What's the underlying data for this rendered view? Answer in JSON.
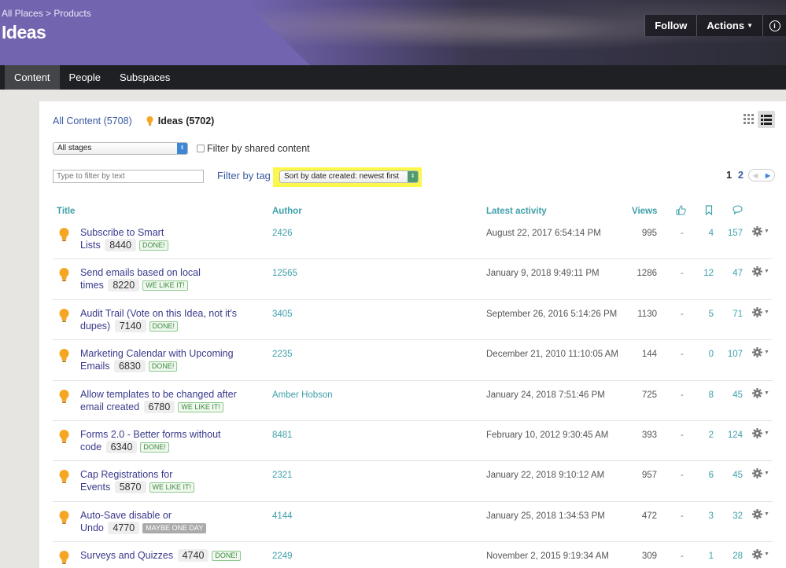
{
  "header": {
    "breadcrumb_root": "All Places",
    "breadcrumb_sep": ">",
    "breadcrumb_current": "Products",
    "title": "Ideas",
    "follow_label": "Follow",
    "actions_label": "Actions",
    "info_label": "i"
  },
  "nav": {
    "tabs": [
      {
        "label": "Content",
        "active": true
      },
      {
        "label": "People",
        "active": false
      },
      {
        "label": "Subspaces",
        "active": false
      }
    ]
  },
  "content": {
    "all_content_label": "All Content (5708)",
    "ideas_label": "Ideas (5702)",
    "stage_select_value": "All stages",
    "shared_filter_label": "Filter by shared content",
    "text_filter_placeholder": "Type to filter by text",
    "tag_filter_label": "Filter by tag",
    "sort_value": "Sort by date created: newest first",
    "pager": {
      "current": "1",
      "next": "2"
    }
  },
  "table": {
    "headers": {
      "title": "Title",
      "author": "Author",
      "activity": "Latest activity",
      "views": "Views"
    },
    "rows": [
      {
        "t1": "Subscribe to Smart",
        "t2": "Lists",
        "score": "8440",
        "badge": "DONE!",
        "badge_style": "green",
        "author": "2426",
        "activity": "August 22, 2017 6:54:14 PM",
        "views": "995",
        "likes": "-",
        "bookmarks": "4",
        "comments": "157"
      },
      {
        "t1": "Send emails based on local",
        "t2": "times",
        "score": "8220",
        "badge": "WE LIKE IT!",
        "badge_style": "green",
        "author": "12565",
        "activity": "January 9, 2018 9:49:11 PM",
        "views": "1286",
        "likes": "-",
        "bookmarks": "12",
        "comments": "47"
      },
      {
        "t1": "Audit Trail (Vote on this Idea, not it's",
        "t2": "dupes)",
        "score": "7140",
        "badge": "DONE!",
        "badge_style": "green",
        "author": "3405",
        "activity": "September 26, 2016 5:14:26 PM",
        "views": "1130",
        "likes": "-",
        "bookmarks": "5",
        "comments": "71"
      },
      {
        "t1": "Marketing Calendar with Upcoming",
        "t2": "Emails",
        "score": "6830",
        "badge": "DONE!",
        "badge_style": "green",
        "author": "2235",
        "activity": "December 21, 2010 11:10:05 AM",
        "views": "144",
        "likes": "-",
        "bookmarks": "0",
        "comments": "107"
      },
      {
        "t1": "Allow templates to be changed after",
        "t2": "email created",
        "score": "6780",
        "badge": "WE LIKE IT!",
        "badge_style": "green",
        "author": "Amber Hobson",
        "activity": "January 24, 2018 7:51:46 PM",
        "views": "725",
        "likes": "-",
        "bookmarks": "8",
        "comments": "45"
      },
      {
        "t1": "Forms 2.0 - Better forms without",
        "t2": "code",
        "score": "6340",
        "badge": "DONE!",
        "badge_style": "green",
        "author": "8481",
        "activity": "February 10, 2012 9:30:45 AM",
        "views": "393",
        "likes": "-",
        "bookmarks": "2",
        "comments": "124"
      },
      {
        "t1": "Cap Registrations for",
        "t2": "Events",
        "score": "5870",
        "badge": "WE LIKE IT!",
        "badge_style": "green",
        "author": "2321",
        "activity": "January 22, 2018 9:10:12 AM",
        "views": "957",
        "likes": "-",
        "bookmarks": "6",
        "comments": "45"
      },
      {
        "t1": "Auto-Save disable or",
        "t2": "Undo",
        "score": "4770",
        "badge": "MAYBE ONE DAY",
        "badge_style": "grey",
        "author": "4144",
        "activity": "January 25, 2018 1:34:53 PM",
        "views": "472",
        "likes": "-",
        "bookmarks": "3",
        "comments": "32"
      },
      {
        "t1": "Surveys and Quizzes",
        "t2": "",
        "score": "4740",
        "badge": "DONE!",
        "badge_style": "green",
        "author": "2249",
        "activity": "November 2, 2015 9:19:34 AM",
        "views": "309",
        "likes": "-",
        "bookmarks": "1",
        "comments": "28"
      }
    ]
  },
  "colors": {
    "banner_purple": "#7364b0",
    "nav_dark": "#1f2024",
    "link_teal": "#3fa0aa",
    "title_purple": "#3a3a8c",
    "sort_highlight": "#fbf84c",
    "bulb_orange": "#f5a623"
  },
  "icons": {
    "bulb": "lightbulb-icon",
    "likes_header": "thumbs-up-icon",
    "bookmarks_header": "bookmark-icon",
    "comments_header": "comment-icon",
    "row_action": "gear-icon"
  }
}
